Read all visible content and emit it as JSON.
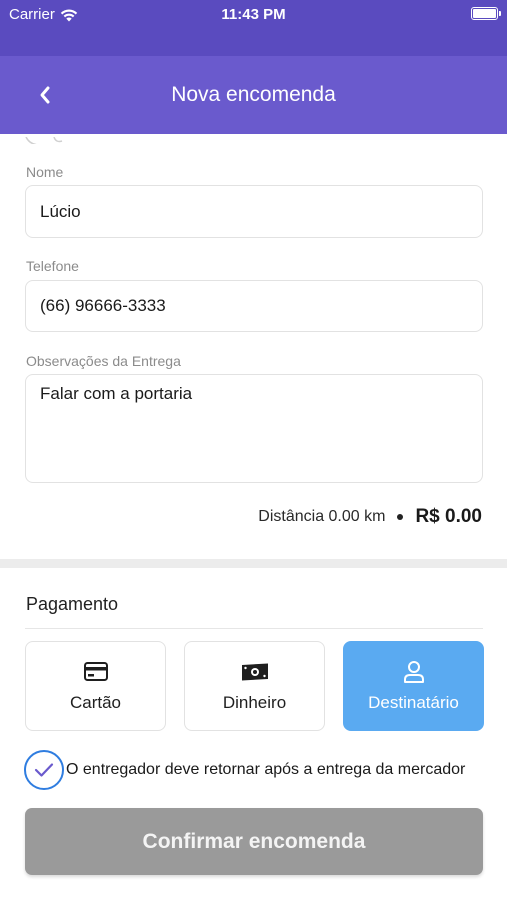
{
  "status_bar": {
    "carrier": "Carrier",
    "time": "11:43 PM",
    "icons": [
      "wifi-icon",
      "battery-icon"
    ]
  },
  "header": {
    "title": "Nova encomenda",
    "back_icon": "chevron-left-icon",
    "background": "#6a5acd"
  },
  "form": {
    "name": {
      "label": "Nome",
      "value": "Lúcio"
    },
    "phone": {
      "label": "Telefone",
      "value": "(66) 96666-3333"
    },
    "notes": {
      "label": "Observações da Entrega",
      "value": "Falar com a portaria"
    }
  },
  "summary": {
    "distance": "Distância 0.00 km",
    "price": "R$ 0.00"
  },
  "payment": {
    "title": "Pagamento",
    "options": [
      {
        "label": "Cartão",
        "icon": "credit-card-icon",
        "selected": false
      },
      {
        "label": "Dinheiro",
        "icon": "cash-icon",
        "selected": false
      },
      {
        "label": "Destinatário",
        "icon": "person-icon",
        "selected": true
      }
    ],
    "selected_color": "#5aaaf1"
  },
  "return_option": {
    "label": "O entregador deve retornar após a entrega da mercador",
    "checked": true
  },
  "confirm": {
    "label": "Confirmar encomenda",
    "enabled": false
  }
}
